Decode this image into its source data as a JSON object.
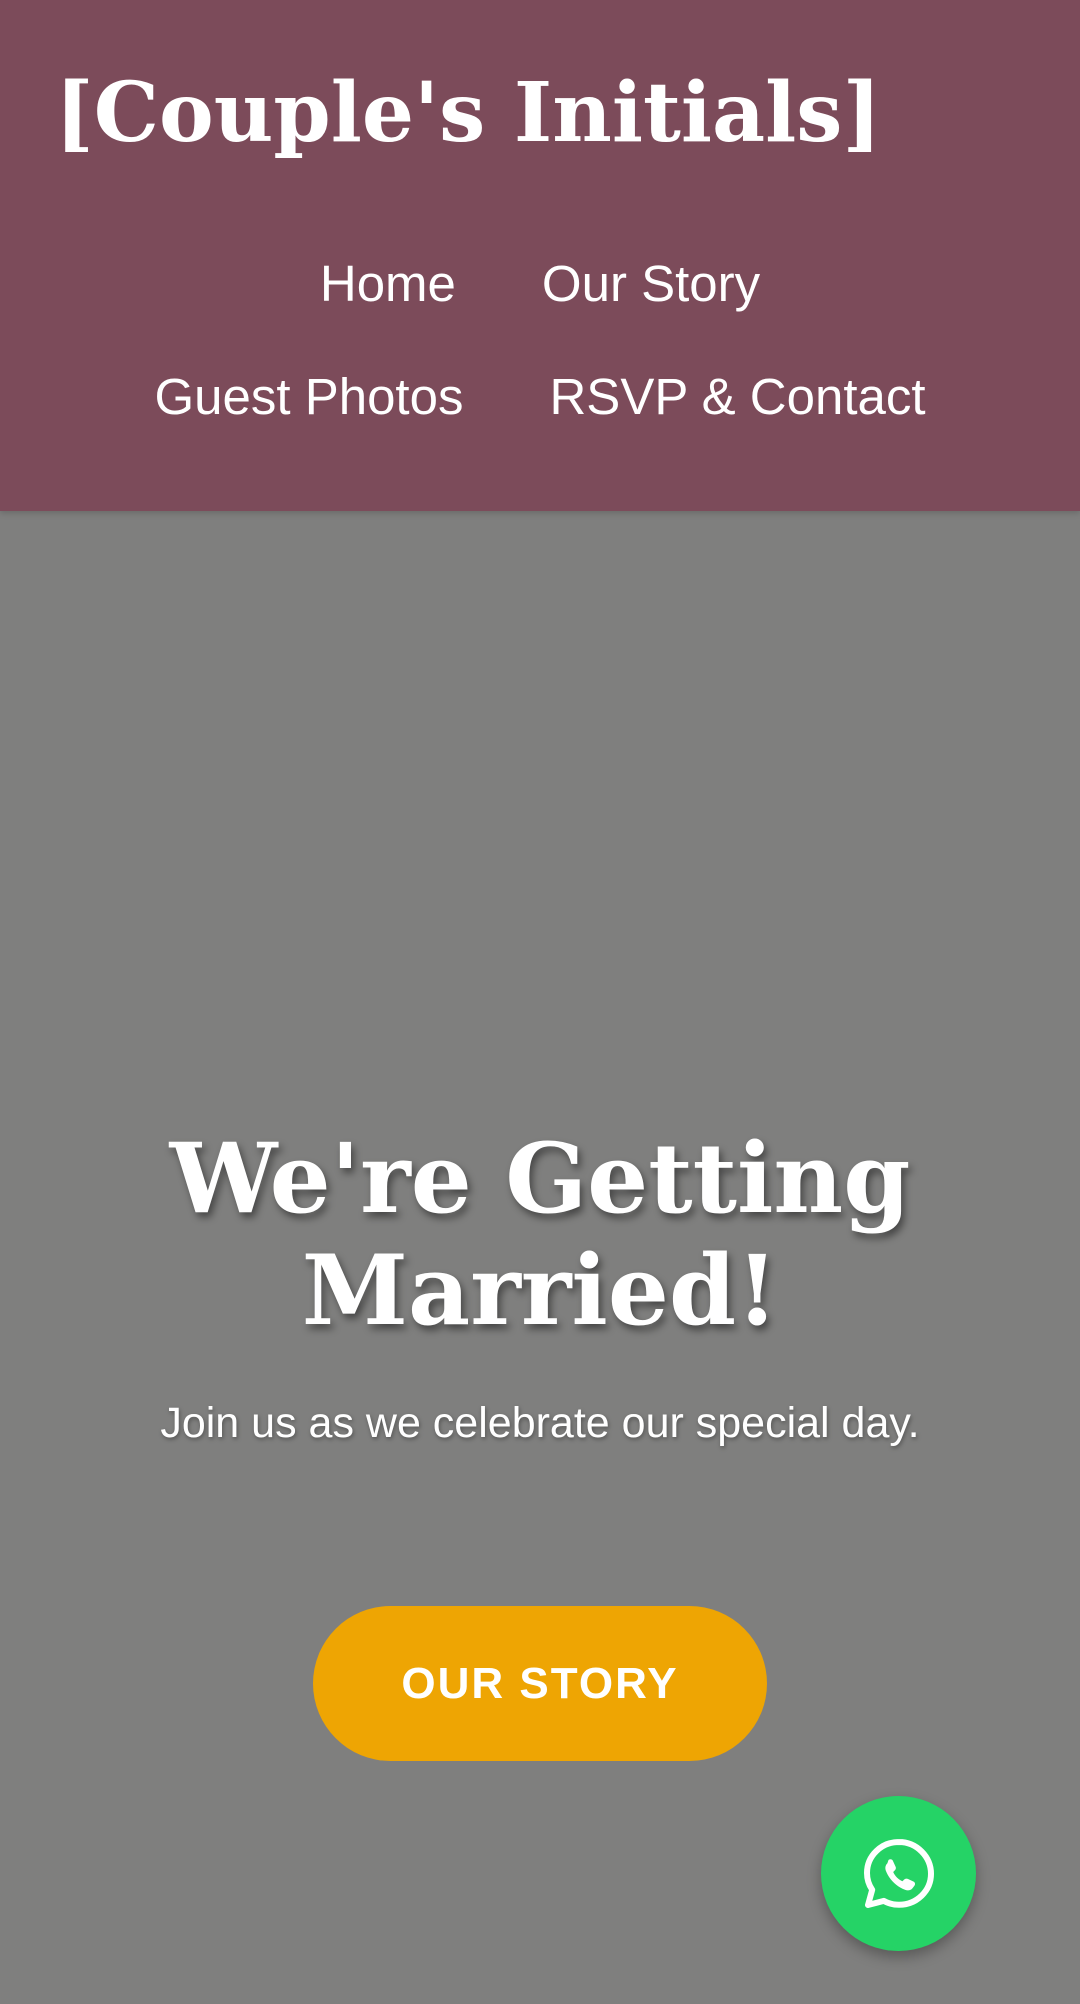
{
  "site": {
    "title": "[Couple's Initials]"
  },
  "nav": {
    "items": [
      {
        "label": "Home"
      },
      {
        "label": "Our Story"
      },
      {
        "label": "Guest Photos"
      },
      {
        "label": "RSVP & Contact"
      }
    ]
  },
  "hero": {
    "title": "We're Getting Married!",
    "subtitle": "Join us as we celebrate our special day.",
    "cta_label": "OUR STORY"
  },
  "floating": {
    "whatsapp_icon": "whatsapp-icon"
  },
  "colors": {
    "header_bg": "#7c4b5a",
    "hero_bg": "#7f7f7e",
    "cta_bg": "#eea503",
    "whatsapp_green": "#25d366",
    "text": "#ffffff"
  }
}
